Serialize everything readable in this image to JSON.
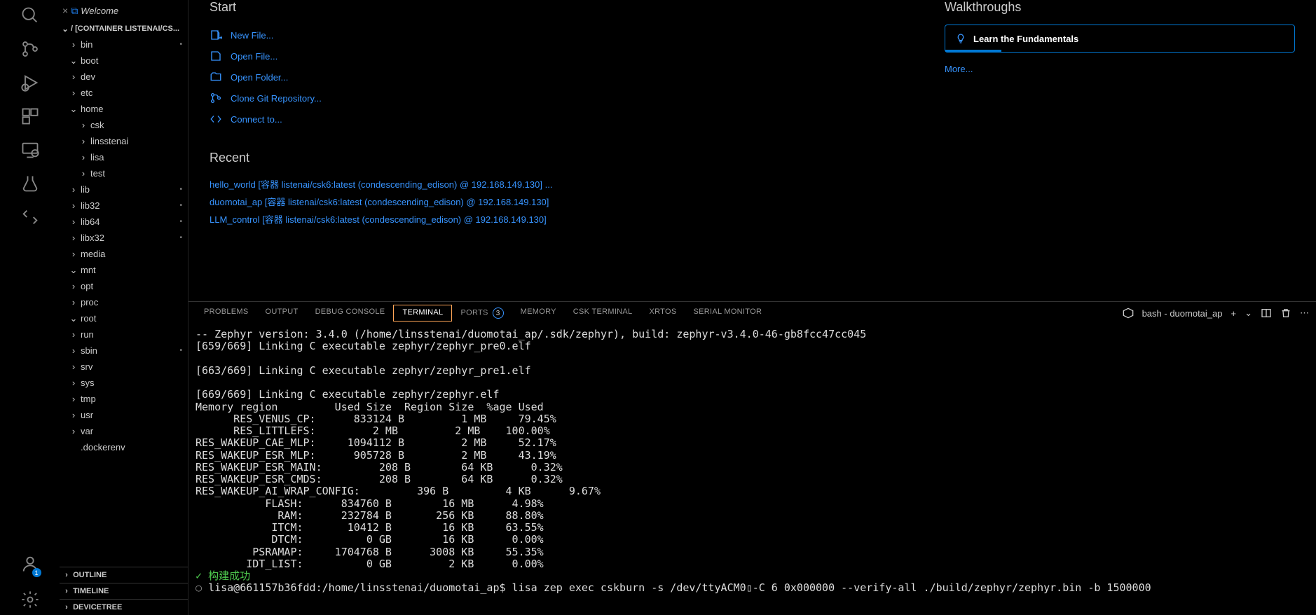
{
  "editorTab": {
    "label": "Welcome"
  },
  "explorer": {
    "root": "/ [CONTAINER LISTENAI/CS...",
    "items": [
      {
        "name": "bin",
        "chev": "›",
        "depth": 1,
        "status": "•"
      },
      {
        "name": "boot",
        "chev": "⌄",
        "depth": 1
      },
      {
        "name": "dev",
        "chev": "›",
        "depth": 1
      },
      {
        "name": "etc",
        "chev": "›",
        "depth": 1
      },
      {
        "name": "home",
        "chev": "⌄",
        "depth": 1
      },
      {
        "name": "csk",
        "chev": "›",
        "depth": 2
      },
      {
        "name": "linsstenai",
        "chev": "›",
        "depth": 2
      },
      {
        "name": "lisa",
        "chev": "›",
        "depth": 2
      },
      {
        "name": "test",
        "chev": "›",
        "depth": 2
      },
      {
        "name": "lib",
        "chev": "›",
        "depth": 1,
        "status": "•"
      },
      {
        "name": "lib32",
        "chev": "›",
        "depth": 1,
        "status": "•"
      },
      {
        "name": "lib64",
        "chev": "›",
        "depth": 1,
        "status": "•"
      },
      {
        "name": "libx32",
        "chev": "›",
        "depth": 1,
        "status": "•"
      },
      {
        "name": "media",
        "chev": "›",
        "depth": 1
      },
      {
        "name": "mnt",
        "chev": "⌄",
        "depth": 1
      },
      {
        "name": "opt",
        "chev": "›",
        "depth": 1
      },
      {
        "name": "proc",
        "chev": "›",
        "depth": 1
      },
      {
        "name": "root",
        "chev": "⌄",
        "depth": 1
      },
      {
        "name": "run",
        "chev": "›",
        "depth": 1
      },
      {
        "name": "sbin",
        "chev": "›",
        "depth": 1,
        "status": "•"
      },
      {
        "name": "srv",
        "chev": "›",
        "depth": 1
      },
      {
        "name": "sys",
        "chev": "›",
        "depth": 1
      },
      {
        "name": "tmp",
        "chev": "›",
        "depth": 1
      },
      {
        "name": "usr",
        "chev": "›",
        "depth": 1
      },
      {
        "name": "var",
        "chev": "›",
        "depth": 1
      },
      {
        "name": ".dockerenv",
        "chev": "",
        "depth": 1,
        "file": true
      }
    ],
    "panels": [
      "OUTLINE",
      "TIMELINE",
      "DEVICETREE"
    ]
  },
  "welcome": {
    "startHeading": "Start",
    "startItems": [
      "New File...",
      "Open File...",
      "Open Folder...",
      "Clone Git Repository...",
      "Connect to..."
    ],
    "recentHeading": "Recent",
    "recentItems": [
      "hello_world [容器 listenai/csk6:latest (condescending_edison) @ 192.168.149.130] ...",
      "duomotai_ap [容器 listenai/csk6:latest (condescending_edison) @ 192.168.149.130]",
      "LLM_control [容器 listenai/csk6:latest (condescending_edison) @ 192.168.149.130]"
    ],
    "walkHeading": "Walkthroughs",
    "walkCard": "Learn the Fundamentals",
    "more": "More..."
  },
  "panelTabs": {
    "items": [
      "PROBLEMS",
      "OUTPUT",
      "DEBUG CONSOLE",
      "TERMINAL",
      "PORTS",
      "MEMORY",
      "CSK TERMINAL",
      "XRTOS",
      "SERIAL MONITOR"
    ],
    "active": "TERMINAL",
    "portsCount": "3",
    "shellLabel": "bash - duomotai_ap"
  },
  "terminal": {
    "body": "-- Zephyr version: 3.4.0 (/home/linsstenai/duomotai_ap/.sdk/zephyr), build: zephyr-v3.4.0-46-gb8fcc47cc045\n[659/669] Linking C executable zephyr/zephyr_pre0.elf\n\n[663/669] Linking C executable zephyr/zephyr_pre1.elf\n\n[669/669] Linking C executable zephyr/zephyr.elf\nMemory region         Used Size  Region Size  %age Used\n      RES_VENUS_CP:      833124 B         1 MB     79.45%\n      RES_LITTLEFS:         2 MB         2 MB    100.00%\nRES_WAKEUP_CAE_MLP:     1094112 B         2 MB     52.17%\nRES_WAKEUP_ESR_MLP:      905728 B         2 MB     43.19%\nRES_WAKEUP_ESR_MAIN:         208 B        64 KB      0.32%\nRES_WAKEUP_ESR_CMDS:         208 B        64 KB      0.32%\nRES_WAKEUP_AI_WRAP_CONFIG:         396 B         4 KB      9.67%\n           FLASH:      834760 B        16 MB      4.98%\n             RAM:      232784 B       256 KB     88.80%\n            ITCM:       10412 B        16 KB     63.55%\n            DTCM:          0 GB        16 KB      0.00%\n         PSRAMAP:     1704768 B      3008 KB     55.35%\n        IDT_LIST:          0 GB         2 KB      0.00%",
    "success": "构建成功",
    "prompt": "lisa@661157b36fdd:/home/linsstenai/duomotai_ap$ lisa zep exec cskburn -s /dev/ttyACM0▯-C 6 0x000000 --verify-all ./build/zephyr/zephyr.bin -b 1500000"
  }
}
